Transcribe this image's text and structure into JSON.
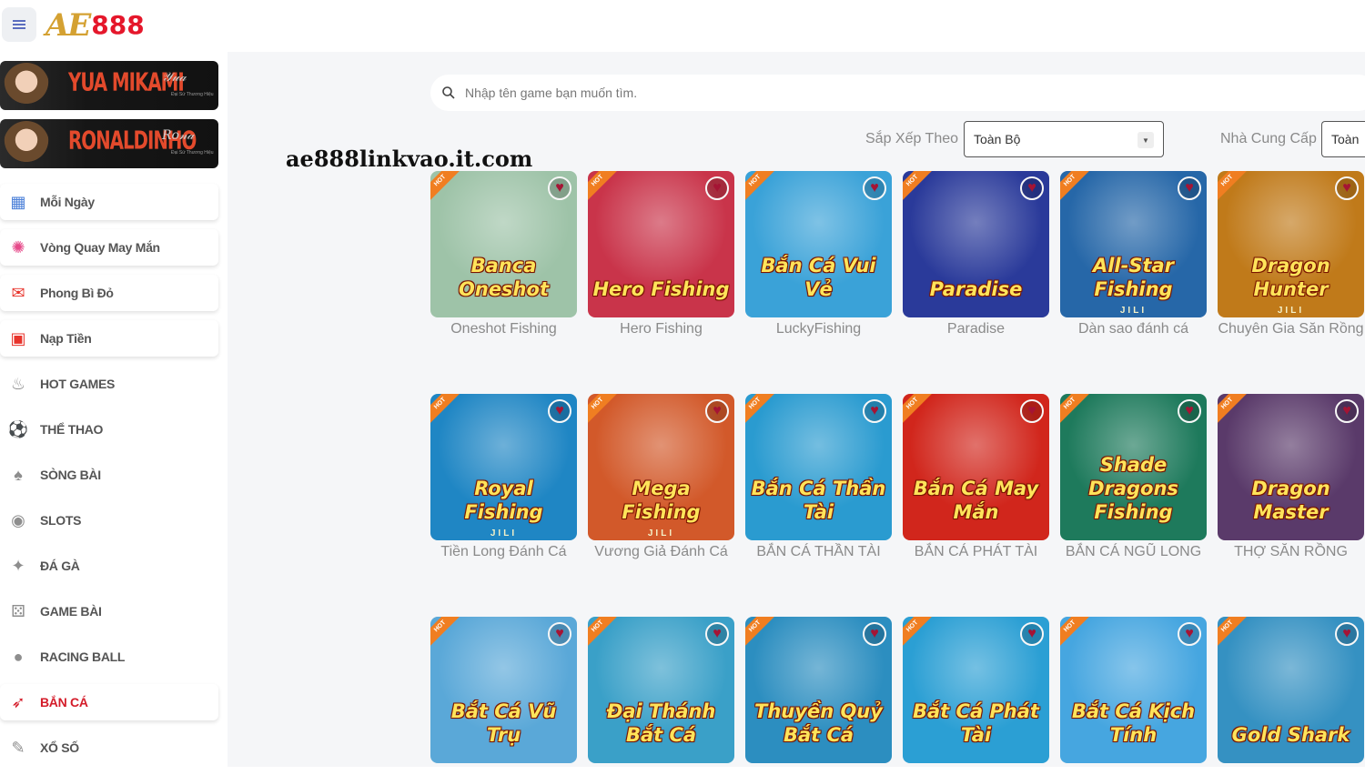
{
  "header": {
    "logo_ae": "AE",
    "logo_num": "888"
  },
  "sidebar": {
    "banners": [
      {
        "name": "YUA MIKAMI",
        "sub": "Đại Sứ Thương Hiệu"
      },
      {
        "name": "RONALDINHO",
        "sub": "Đại Sứ Thương Hiệu"
      }
    ],
    "items": [
      {
        "label": "Mỗi Ngày",
        "icon": "calendar-icon"
      },
      {
        "label": "Vòng Quay May Mắn",
        "icon": "wheel-icon"
      },
      {
        "label": "Phong Bì Đỏ",
        "icon": "red-envelope-icon"
      },
      {
        "label": "Nạp Tiền",
        "icon": "deposit-icon"
      },
      {
        "label": "HOT GAMES",
        "icon": "flame-icon"
      },
      {
        "label": "THỂ THAO",
        "icon": "soccer-ball-icon"
      },
      {
        "label": "SÒNG BÀI",
        "icon": "cards-icon"
      },
      {
        "label": "SLOTS",
        "icon": "slot-machine-icon"
      },
      {
        "label": "ĐÁ GÀ",
        "icon": "rooster-icon"
      },
      {
        "label": "GAME BÀI",
        "icon": "dice-icon"
      },
      {
        "label": "RACING BALL",
        "icon": "ball-icon"
      },
      {
        "label": "BẮN CÁ",
        "icon": "fish-gun-icon"
      },
      {
        "label": "XỔ SỐ",
        "icon": "ticket-icon"
      }
    ],
    "active": "BẮN CÁ"
  },
  "watermark": "ae888linkvao.it.com",
  "search": {
    "placeholder": "Nhập tên game bạn muốn tìm."
  },
  "filters": {
    "sort_label": "Sắp Xếp Theo",
    "sort_value": "Toàn Bộ",
    "provider_label": "Nhà Cung Cấp",
    "provider_value": "Toàn"
  },
  "games": [
    {
      "name": "Oneshot Fishing",
      "art": "Banca Oneshot",
      "bg": "#9ec3a8",
      "jili": ""
    },
    {
      "name": "Hero Fishing",
      "art": "Hero Fishing",
      "bg": "#c9344a",
      "jili": ""
    },
    {
      "name": "LuckyFishing",
      "art": "Bắn Cá Vui Vẻ",
      "bg": "#3aa2d8",
      "jili": ""
    },
    {
      "name": "Paradise",
      "art": "Paradise",
      "bg": "#2a3a9a",
      "jili": ""
    },
    {
      "name": "Dàn sao đánh cá",
      "art": "All-Star Fishing",
      "bg": "#2667a8",
      "jili": "JILI"
    },
    {
      "name": "Chuyên Gia Săn Rồng",
      "art": "Dragon Hunter",
      "bg": "#c07a1a",
      "jili": "JILI"
    },
    {
      "name": "Tiền Long Đánh Cá",
      "art": "Royal Fishing",
      "bg": "#1f86c4",
      "jili": "JILI"
    },
    {
      "name": "Vương Giả Đánh Cá",
      "art": "Mega Fishing",
      "bg": "#d2592a",
      "jili": "JILI"
    },
    {
      "name": "BẮN CÁ THẦN TÀI",
      "art": "Bắn Cá Thần Tài",
      "bg": "#2a9bd0",
      "jili": ""
    },
    {
      "name": "BẮN CÁ PHÁT TÀI",
      "art": "Bắn Cá May Mắn",
      "bg": "#d1261c",
      "jili": ""
    },
    {
      "name": "BẮN CÁ NGŨ LONG",
      "art": "Shade Dragons Fishing",
      "bg": "#1e7a5c",
      "jili": ""
    },
    {
      "name": "THỢ SĂN RỒNG",
      "art": "Dragon Master",
      "bg": "#5a3a6a",
      "jili": ""
    },
    {
      "name": "",
      "art": "Bắt Cá Vũ Trụ",
      "bg": "#5aa8d8",
      "jili": ""
    },
    {
      "name": "",
      "art": "Đại Thánh Bắt Cá",
      "bg": "#3aa0c8",
      "jili": ""
    },
    {
      "name": "",
      "art": "Thuyền Quỷ Bắt Cá",
      "bg": "#2c8ec0",
      "jili": ""
    },
    {
      "name": "",
      "art": "Bắt Cá Phát Tài",
      "bg": "#2b9fd4",
      "jili": ""
    },
    {
      "name": "",
      "art": "Bắt Cá Kịch Tính",
      "bg": "#46a6e0",
      "jili": ""
    },
    {
      "name": "",
      "art": "Gold Shark",
      "bg": "#3591c2",
      "jili": ""
    }
  ],
  "hot_badge": "HOT",
  "colors": {
    "accent_red": "#d41c2a",
    "brand_gold": "#d4a132"
  }
}
